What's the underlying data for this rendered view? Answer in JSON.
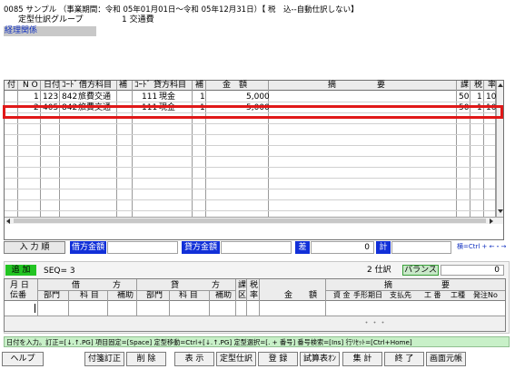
{
  "title": "0085 サンプル （事業期間：令和 05年01月01日～令和 05年12月31日）【 税　込--自動仕訳しない】",
  "group": {
    "label": "定型仕訳グループ",
    "value": "1 交通費"
  },
  "keiri_label": "経理関係",
  "table": {
    "headers": {
      "tsuki": "付",
      "no": "N O",
      "hidzuke": "日付",
      "code1": "ｺｰﾄﾞ",
      "kari_kamoku": "借方科目",
      "ho1": "補",
      "code2": "ｺｰﾄﾞ",
      "kashi_kamoku": "貸方科目",
      "ho2": "補",
      "kingaku": "金　額",
      "tekiyo": "摘　　　　　要",
      "ka": "課",
      "zei": "税",
      "ritsu": "率"
    },
    "rows": [
      {
        "no": "1",
        "date": "123",
        "code1": "842",
        "debit": "旅費交通",
        "code2": "111",
        "credit": "現金",
        "ho2": "1",
        "amount": "5,000",
        "ka": "50",
        "zei": "1",
        "ritsu": "10"
      },
      {
        "no": "2",
        "date": "405",
        "code1": "842",
        "debit": "旅費交通",
        "code2": "111",
        "credit": "現金",
        "ho2": "1",
        "amount": "5,000",
        "ka": "50",
        "zei": "1",
        "ritsu": "10"
      }
    ]
  },
  "totals": {
    "input_order": "入 力 順",
    "debit_total": "借方金額",
    "credit_total": "貸方金額",
    "diff_label": "差",
    "diff_value": "0",
    "kei": "計",
    "hint": "横=Ctrl + ←・→"
  },
  "entry": {
    "mode": "追 加",
    "seq": "SEQ= 3",
    "count": "2 仕訳",
    "balance_label": "バランス",
    "balance_value": "0"
  },
  "form_headers": {
    "tsuki": "月 日",
    "denban": "伝番",
    "kari": "借　　　　方",
    "kashi": "貸　　　　方",
    "bumon1": "部門",
    "kamoku1": "科 目",
    "hojo1": "補助",
    "bumon2": "部門",
    "kamoku2": "科 目",
    "hojo2": "補助",
    "ka": "課",
    "kbn": "税",
    "ho": "区",
    "ritsu": "率",
    "kingaku": "金　　額",
    "tekiyo": "摘　　　　　　要",
    "shikin": "資 金",
    "tegata": "手形期日",
    "shiharai": "支払先",
    "koban": "工 番",
    "koshu": "工種",
    "hatchu": "発注No",
    "dots": "・・・"
  },
  "status": "日付を入力。訂正=[↓.↑.PG] 項目固定=[Space] 定型移動=Ctrl+[↓.↑.PG] 定型選択=[. + 番号] 番号検索=[Ins] 行ﾘｾｯﾄ=[Ctrl+Home]",
  "buttons": [
    "ヘルプ",
    "付箋訂正",
    "削 除",
    "表 示",
    "定型仕訳",
    "登 録",
    "試算表ｵﾝ",
    "集 計",
    "終 了",
    "画面元帳"
  ]
}
